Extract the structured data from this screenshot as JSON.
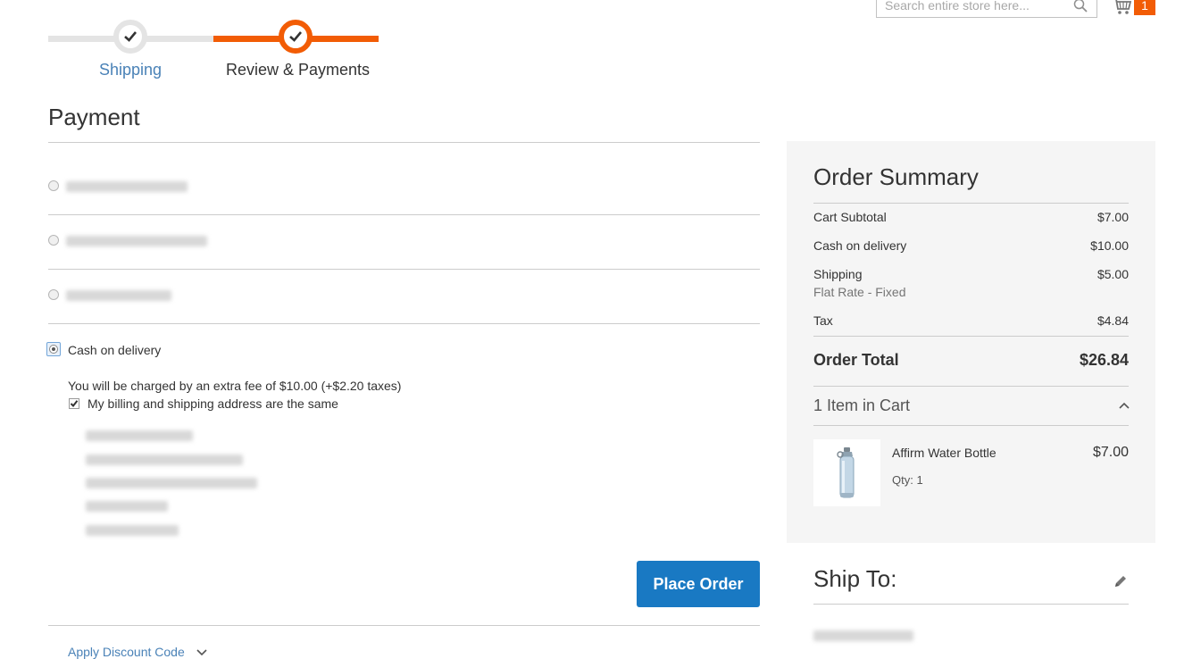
{
  "header": {
    "search_placeholder": "Search entire store here...",
    "cart_count": "1",
    "accent_color": "#f25c05"
  },
  "progress": {
    "steps": [
      {
        "label": "Shipping",
        "state": "done"
      },
      {
        "label": "Review & Payments",
        "state": "active"
      }
    ]
  },
  "payment": {
    "title": "Payment",
    "selected_method": "Cash on delivery",
    "fee_note": "You will be charged by an extra fee of $10.00 (+$2.20 taxes)",
    "same_address_label": "My billing and shipping address are the same",
    "same_address_checked": true,
    "place_order_label": "Place Order",
    "discount_link": "Apply Discount Code"
  },
  "summary": {
    "title": "Order Summary",
    "rows": [
      {
        "label": "Cart Subtotal",
        "value": "$7.00"
      },
      {
        "label": "Cash on delivery",
        "value": "$10.00"
      },
      {
        "label": "Shipping",
        "value": "$5.00",
        "sub": "Flat Rate - Fixed"
      },
      {
        "label": "Tax",
        "value": "$4.84"
      }
    ],
    "total_label": "Order Total",
    "total_value": "$26.84",
    "items_in_cart": "1 Item in Cart",
    "item": {
      "name": "Affirm Water Bottle",
      "price": "$7.00",
      "qty": "Qty: 1"
    }
  },
  "ship_to": {
    "title": "Ship To:"
  }
}
